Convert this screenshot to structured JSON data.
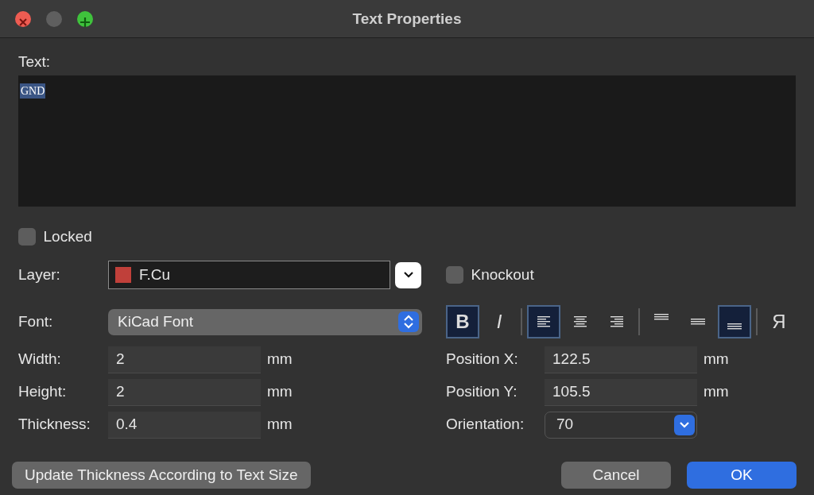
{
  "window": {
    "title": "Text Properties"
  },
  "text_field": {
    "label": "Text:",
    "value": "GND",
    "selected": true
  },
  "locked": {
    "label": "Locked",
    "checked": false
  },
  "layer": {
    "label": "Layer:",
    "value": "F.Cu",
    "color": "#c0403a"
  },
  "knockout": {
    "label": "Knockout",
    "checked": false
  },
  "font": {
    "label": "Font:",
    "value": "KiCad Font"
  },
  "toolbar": [
    [
      {
        "kind": "bold",
        "text": "B",
        "selected": true
      },
      {
        "kind": "italic",
        "text": "I",
        "selected": false
      }
    ],
    [
      {
        "kind": "align-left",
        "selected": true
      },
      {
        "kind": "align-center",
        "selected": false
      },
      {
        "kind": "align-right",
        "selected": false
      }
    ],
    [
      {
        "kind": "valign-top",
        "selected": false
      },
      {
        "kind": "valign-center",
        "selected": false
      },
      {
        "kind": "valign-bottom",
        "selected": true
      }
    ],
    [
      {
        "kind": "mirror",
        "text": "Я",
        "selected": false
      }
    ]
  ],
  "size_fields": [
    {
      "label": "Width:",
      "value": "2",
      "unit": "mm"
    },
    {
      "label": "Height:",
      "value": "2",
      "unit": "mm"
    },
    {
      "label": "Thickness:",
      "value": "0.4",
      "unit": "mm"
    }
  ],
  "position_fields": [
    {
      "kind": "text",
      "label": "Position X:",
      "value": "122.5",
      "unit": "mm"
    },
    {
      "kind": "text",
      "label": "Position Y:",
      "value": "105.5",
      "unit": "mm"
    },
    {
      "kind": "dropdown",
      "label": "Orientation:",
      "value": "70"
    }
  ],
  "buttons": [
    {
      "label": "Update Thickness According to Text Size",
      "primary": false
    },
    {
      "label": "Cancel",
      "primary": false
    },
    {
      "label": "OK",
      "primary": true
    }
  ]
}
